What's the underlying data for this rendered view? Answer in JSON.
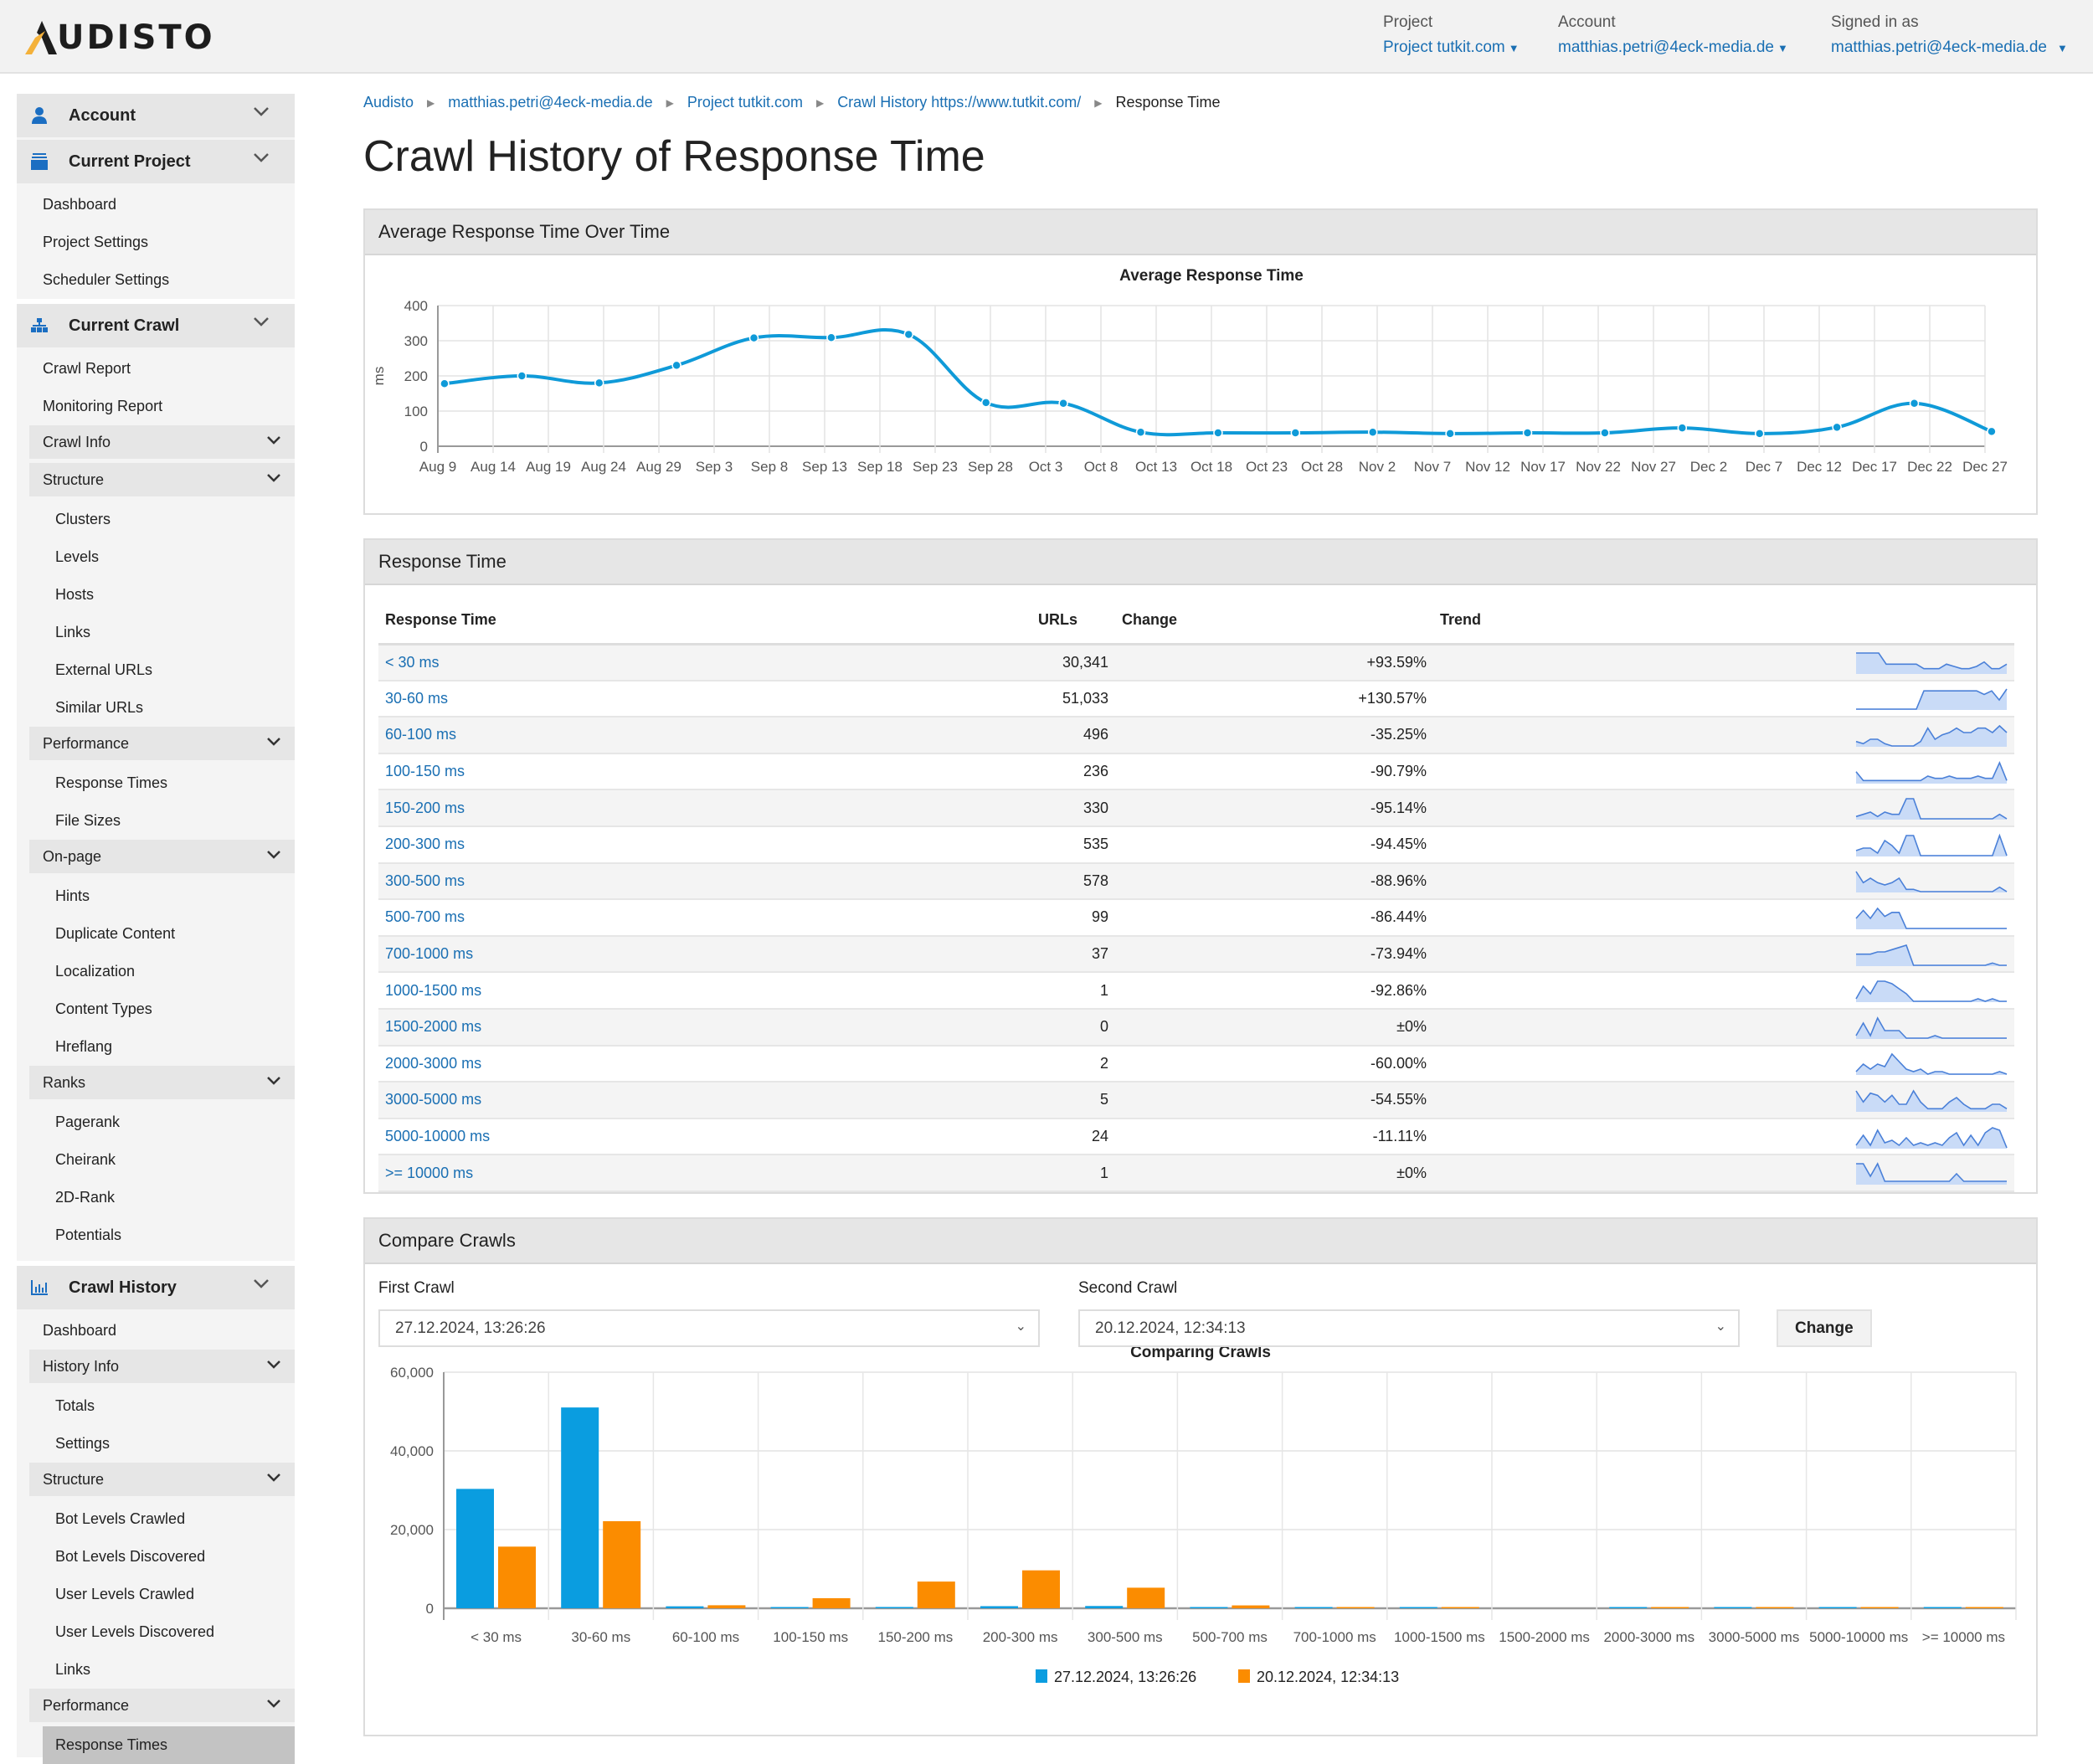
{
  "header": {
    "logo_text": "UDISTO",
    "project_label": "Project",
    "project_value": "Project tutkit.com",
    "account_label": "Account",
    "account_value": "matthias.petri@4eck-media.de",
    "signed_label": "Signed in as",
    "signed_value": "matthias.petri@4eck-media.de"
  },
  "sidebar": {
    "account": "Account",
    "current_project": "Current Project",
    "project_items": [
      "Dashboard",
      "Project Settings",
      "Scheduler Settings"
    ],
    "current_crawl": "Current Crawl",
    "crawl_items": [
      "Crawl Report",
      "Monitoring Report"
    ],
    "crawl_info": "Crawl Info",
    "structure": "Structure",
    "structure_items": [
      "Clusters",
      "Levels",
      "Hosts",
      "Links",
      "External URLs",
      "Similar URLs"
    ],
    "performance": "Performance",
    "performance_items": [
      "Response Times",
      "File Sizes"
    ],
    "onpage": "On-page",
    "onpage_items": [
      "Hints",
      "Duplicate Content",
      "Localization",
      "Content Types",
      "Hreflang"
    ],
    "ranks": "Ranks",
    "ranks_items": [
      "Pagerank",
      "Cheirank",
      "2D-Rank",
      "Potentials"
    ],
    "crawl_history": "Crawl History",
    "history_dashboard": "Dashboard",
    "history_info": "History Info",
    "history_info_items": [
      "Totals",
      "Settings"
    ],
    "history_structure": "Structure",
    "history_structure_items": [
      "Bot Levels Crawled",
      "Bot Levels Discovered",
      "User Levels Crawled",
      "User Levels Discovered",
      "Links"
    ],
    "history_performance": "Performance",
    "history_performance_active": "Response Times"
  },
  "breadcrumb": [
    "Audisto",
    "matthias.petri@4eck-media.de",
    "Project tutkit.com",
    "Crawl History https://www.tutkit.com/",
    "Response Time"
  ],
  "page_title": "Crawl History of Response Time",
  "avg_panel_title": "Average Response Time Over Time",
  "table_panel_title": "Response Time",
  "table": {
    "headers": [
      "Response Time",
      "URLs",
      "Change",
      "Trend"
    ],
    "rows": [
      {
        "label": "< 30 ms",
        "urls": "30,341",
        "change": "+93.59%",
        "trend": [
          9,
          9,
          9,
          9,
          4,
          4,
          4,
          4,
          4,
          2,
          2,
          2,
          4,
          3,
          2,
          2,
          3,
          5,
          2,
          2,
          4
        ]
      },
      {
        "label": "30-60 ms",
        "urls": "51,033",
        "change": "+130.57%",
        "trend": [
          0,
          0,
          0,
          0,
          0,
          0,
          0,
          0,
          0,
          10,
          10,
          10,
          10,
          10,
          10,
          10,
          10,
          8,
          10,
          5,
          11
        ]
      },
      {
        "label": "60-100 ms",
        "urls": "496",
        "change": "-35.25%",
        "trend": [
          2,
          1,
          3,
          3,
          1,
          0,
          0,
          0,
          0,
          2,
          8,
          3,
          5,
          6,
          8,
          6,
          6,
          8,
          8,
          6,
          9,
          6
        ]
      },
      {
        "label": "100-150 ms",
        "urls": "236",
        "change": "-90.79%",
        "trend": [
          5,
          1,
          1,
          1,
          1,
          1,
          1,
          1,
          1,
          1,
          3,
          2,
          2,
          3,
          2,
          2,
          2,
          3,
          2,
          2,
          9,
          1
        ]
      },
      {
        "label": "150-200 ms",
        "urls": "330",
        "change": "-95.14%",
        "trend": [
          1,
          2,
          3,
          1,
          3,
          2,
          2,
          9,
          9,
          0,
          0,
          0,
          0,
          0,
          0,
          0,
          0,
          0,
          0,
          0,
          2,
          0
        ]
      },
      {
        "label": "200-300 ms",
        "urls": "535",
        "change": "-94.45%",
        "trend": [
          2,
          3,
          3,
          1,
          6,
          4,
          1,
          8,
          8,
          0,
          0,
          0,
          0,
          0,
          0,
          0,
          0,
          0,
          0,
          0,
          8,
          0
        ]
      },
      {
        "label": "300-500 ms",
        "urls": "578",
        "change": "-88.96%",
        "trend": [
          9,
          4,
          6,
          4,
          3,
          4,
          6,
          1,
          1,
          0,
          0,
          0,
          0,
          0,
          0,
          0,
          0,
          0,
          0,
          0,
          2,
          0
        ]
      },
      {
        "label": "500-700 ms",
        "urls": "99",
        "change": "-86.44%",
        "trend": [
          5,
          9,
          5,
          10,
          6,
          8,
          8,
          0,
          0,
          0,
          0,
          0,
          0,
          0,
          0,
          0,
          0,
          0,
          0,
          0,
          0,
          0
        ]
      },
      {
        "label": "700-1000 ms",
        "urls": "37",
        "change": "-73.94%",
        "trend": [
          5,
          5,
          5,
          6,
          6,
          7,
          8,
          9,
          0,
          0,
          0,
          0,
          0,
          0,
          0,
          0,
          0,
          0,
          0,
          1,
          0,
          0
        ]
      },
      {
        "label": "1000-1500 ms",
        "urls": "1",
        "change": "-92.86%",
        "trend": [
          1,
          6,
          3,
          8,
          8,
          7,
          5,
          3,
          0,
          0,
          0,
          0,
          0,
          0,
          0,
          0,
          0,
          1,
          0,
          1,
          0,
          0
        ]
      },
      {
        "label": "1500-2000 ms",
        "urls": "0",
        "change": "±0%",
        "trend": [
          1,
          6,
          1,
          8,
          3,
          3,
          3,
          0,
          0,
          0,
          0,
          1,
          0,
          0,
          0,
          0,
          0,
          0,
          0,
          0,
          0,
          0
        ]
      },
      {
        "label": "2000-3000 ms",
        "urls": "2",
        "change": "-60.00%",
        "trend": [
          1,
          4,
          2,
          4,
          3,
          8,
          5,
          2,
          1,
          2,
          0,
          1,
          1,
          0,
          0,
          0,
          0,
          0,
          0,
          0,
          1,
          0
        ]
      },
      {
        "label": "3000-5000 ms",
        "urls": "5",
        "change": "-54.55%",
        "trend": [
          9,
          4,
          8,
          7,
          4,
          7,
          3,
          3,
          9,
          4,
          1,
          1,
          1,
          4,
          6,
          3,
          1,
          1,
          1,
          3,
          3,
          1
        ]
      },
      {
        "label": "5000-10000 ms",
        "urls": "24",
        "change": "-11.11%",
        "trend": [
          1,
          5,
          1,
          7,
          2,
          3,
          1,
          4,
          1,
          2,
          1,
          2,
          1,
          4,
          6,
          1,
          5,
          1,
          6,
          8,
          7,
          0
        ]
      },
      {
        "label": ">= 10000 ms",
        "urls": "1",
        "change": "±0%",
        "trend": [
          8,
          8,
          3,
          8,
          1,
          1,
          1,
          1,
          1,
          1,
          1,
          1,
          1,
          1,
          4,
          1,
          1,
          1,
          1,
          1,
          1,
          1
        ]
      }
    ]
  },
  "compare": {
    "panel_title": "Compare Crawls",
    "first_label": "First Crawl",
    "first_value": "27.12.2024, 13:26:26",
    "second_label": "Second Crawl",
    "second_value": "20.12.2024, 12:34:13",
    "change_button": "Change"
  },
  "colors": {
    "link": "#1a6fb3",
    "line": "#0f9ad8",
    "bar_first": "#0a9de0",
    "bar_second": "#fb8c00",
    "spark_line": "#4a80d8",
    "spark_fill": "#c9dbf7",
    "icon_blue": "#1b6ec2",
    "logo_orange": "#f4b13a"
  },
  "chart_data": [
    {
      "type": "line",
      "title": "Average Response Time",
      "xlabel": "",
      "ylabel": "ms",
      "ylim": [
        0,
        400
      ],
      "yticks": [
        0,
        100,
        200,
        300,
        400
      ],
      "xticks": [
        "Aug 9",
        "Aug 14",
        "Aug 19",
        "Aug 24",
        "Aug 29",
        "Sep 3",
        "Sep 8",
        "Sep 13",
        "Sep 18",
        "Sep 23",
        "Sep 28",
        "Oct 3",
        "Oct 8",
        "Oct 13",
        "Oct 18",
        "Oct 23",
        "Oct 28",
        "Nov 2",
        "Nov 7",
        "Nov 12",
        "Nov 17",
        "Nov 22",
        "Nov 27",
        "Dec 2",
        "Dec 7",
        "Dec 12",
        "Dec 17",
        "Dec 22",
        "Dec 27"
      ],
      "grid": true,
      "series": [
        {
          "name": "Average Response Time",
          "x_day_offset": [
            0.6,
            7.6,
            14.6,
            21.6,
            28.6,
            35.6,
            42.6,
            49.6,
            56.6,
            63.6,
            70.6,
            77.6,
            84.6,
            91.6,
            98.6,
            105.6,
            112.6,
            119.6,
            126.6,
            133.6,
            140.6,
            147.6,
            154.6,
            161.6,
            168.3
          ],
          "values": [
            178,
            200,
            180,
            230,
            308,
            309,
            318,
            124,
            122,
            40,
            38,
            38,
            40,
            36,
            38,
            38,
            52,
            36,
            54,
            122,
            42
          ]
        }
      ]
    },
    {
      "type": "bar",
      "title": "Comparing Crawls",
      "categories": [
        "< 30 ms",
        "30-60 ms",
        "60-100 ms",
        "100-150 ms",
        "150-200 ms",
        "200-300 ms",
        "300-500 ms",
        "500-700 ms",
        "700-1000 ms",
        "1000-1500 ms",
        "1500-2000 ms",
        "2000-3000 ms",
        "3000-5000 ms",
        "5000-10000 ms",
        ">= 10000 ms"
      ],
      "ylim": [
        0,
        60000
      ],
      "yticks": [
        "0",
        "20,000",
        "40,000",
        "60,000"
      ],
      "ytick_values": [
        0,
        20000,
        40000,
        60000
      ],
      "grid": true,
      "legend": "bottom-center",
      "series": [
        {
          "name": "27.12.2024, 13:26:26",
          "values": [
            30341,
            51033,
            496,
            236,
            330,
            535,
            578,
            99,
            37,
            1,
            0,
            2,
            5,
            24,
            1
          ]
        },
        {
          "name": "20.12.2024, 12:34:13",
          "values": [
            15670,
            22130,
            766,
            2560,
            6790,
            9640,
            5230,
            730,
            142,
            14,
            0,
            5,
            11,
            27,
            1
          ]
        }
      ]
    }
  ]
}
